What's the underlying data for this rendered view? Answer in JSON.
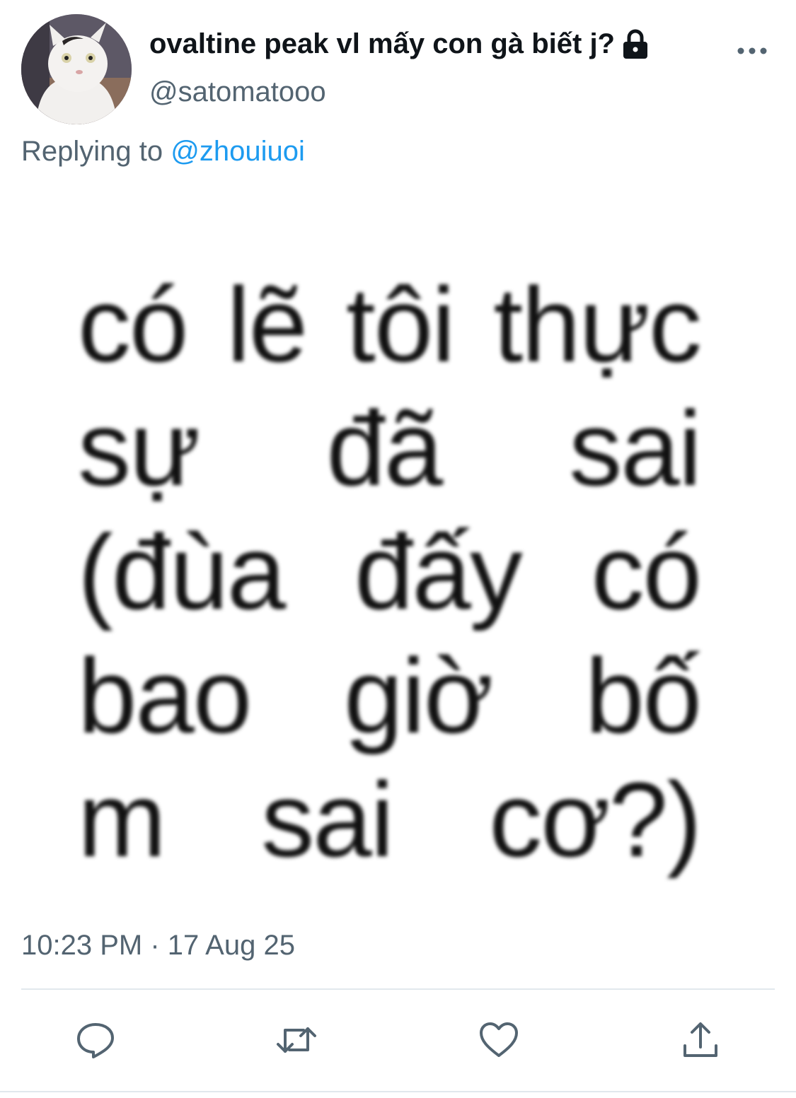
{
  "tweet": {
    "author": {
      "display_name": "ovaltine peak vl mấy con gà biết j?",
      "handle": "@satomatooo",
      "protected_icon": "lock-icon",
      "avatar_icon": "cat-avatar"
    },
    "reply": {
      "prefix": "Replying to",
      "target": "@zhouiuoi"
    },
    "media_text_lines": [
      [
        "có",
        "lẽ",
        "tôi",
        "thực"
      ],
      [
        "sự",
        "đã",
        "sai"
      ],
      [
        "(đùa",
        "đấy",
        "có"
      ],
      [
        "bao",
        "giờ",
        "bố"
      ],
      [
        "m",
        "sai",
        "cơ?)"
      ]
    ],
    "timestamp": "10:23 PM · 17 Aug 25",
    "actions": {
      "reply": "reply-icon",
      "retweet": "retweet-icon",
      "like": "heart-icon",
      "share": "share-icon",
      "more": "more-icon"
    },
    "colors": {
      "link": "#1d9bf0",
      "secondary_text": "#536471",
      "primary_text": "#0f1419"
    }
  }
}
